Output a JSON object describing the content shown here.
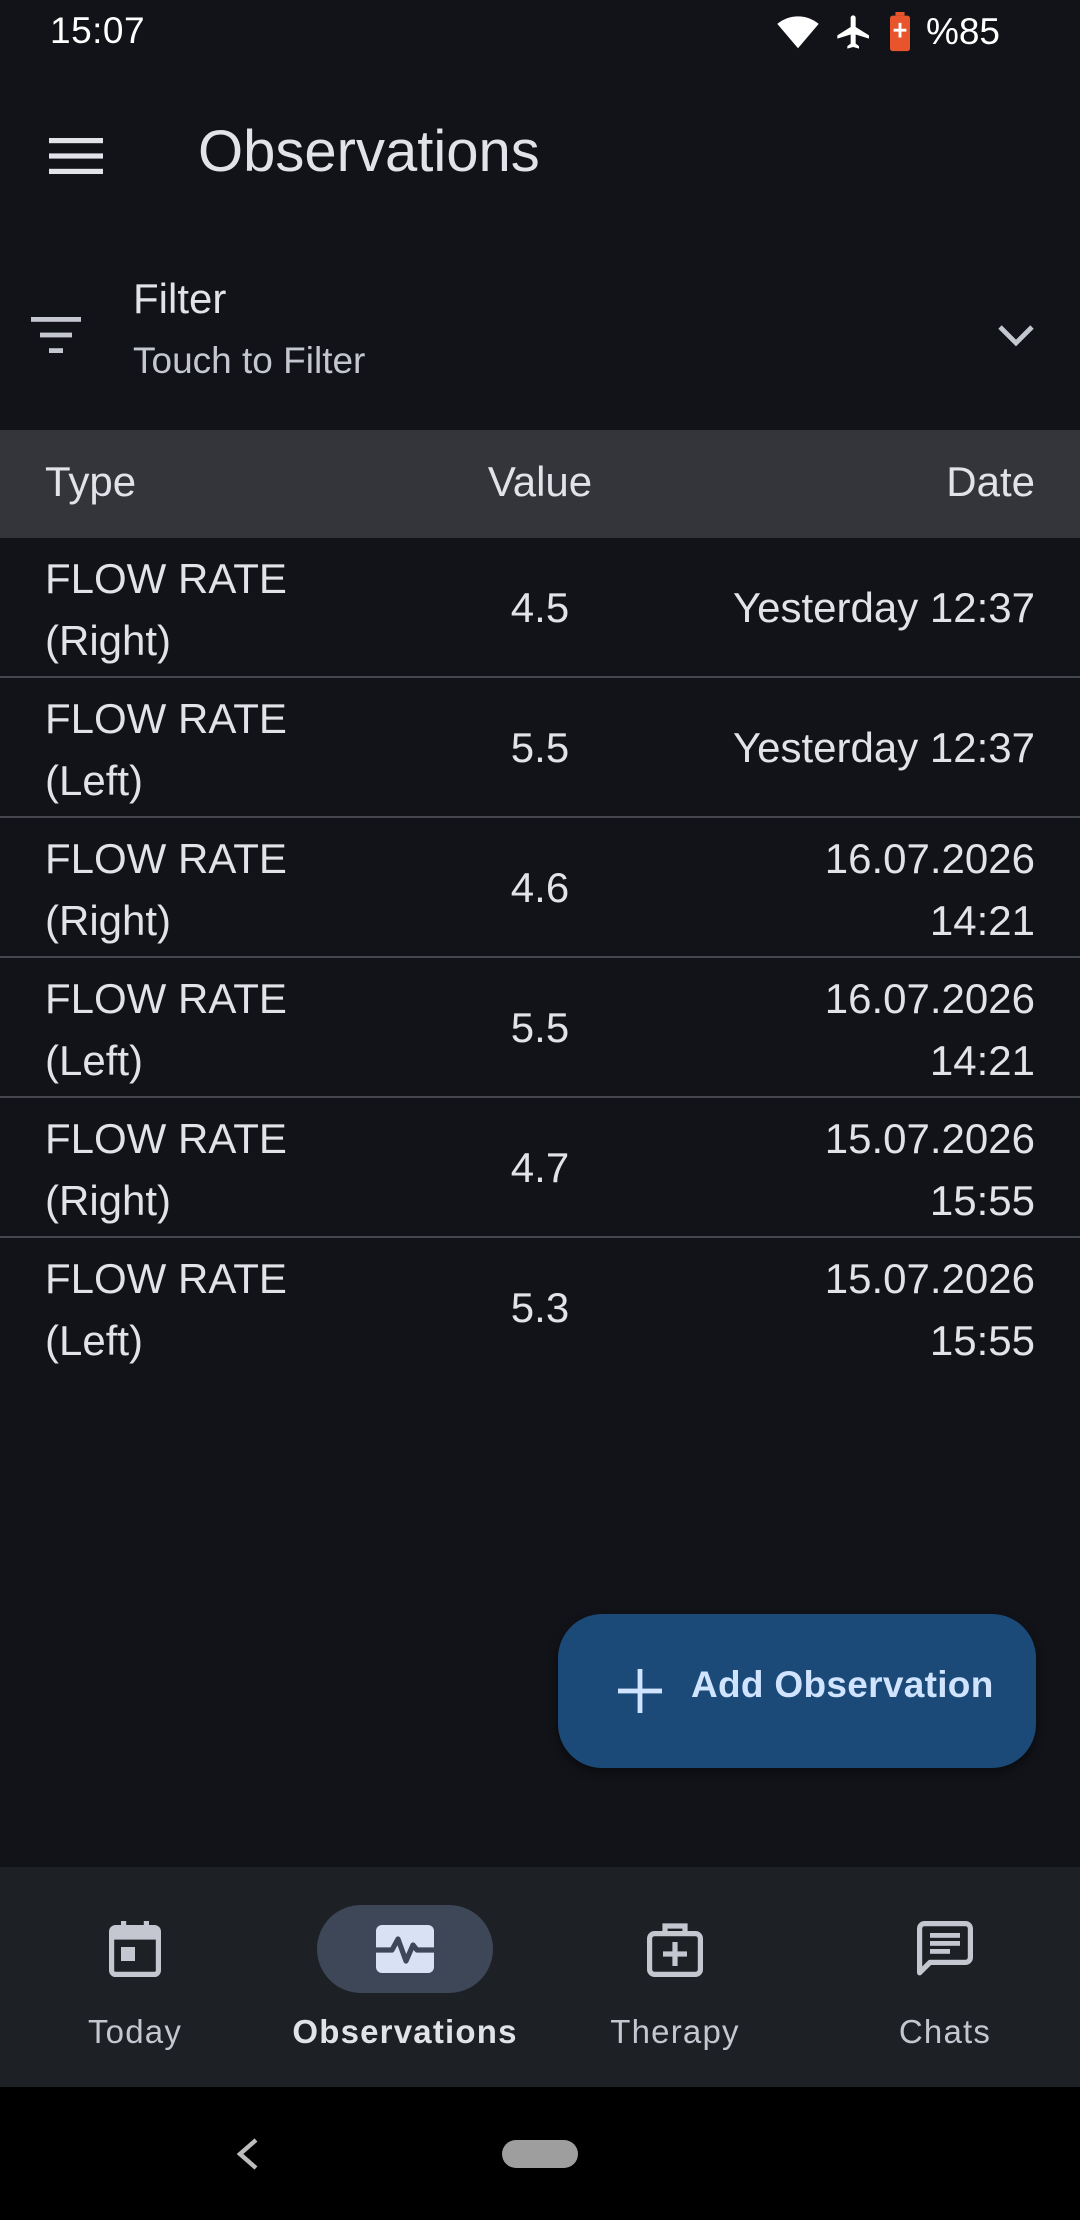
{
  "status_bar": {
    "time": "15:07",
    "battery_percent": "%85",
    "icons": [
      "wifi-icon",
      "airplane-mode-icon",
      "battery-icon"
    ],
    "battery_color": "#e8552d"
  },
  "app_bar": {
    "title": "Observations",
    "menu_icon": "menu-icon"
  },
  "filter": {
    "title": "Filter",
    "subtitle": "Touch to Filter",
    "icon": "filter-icon",
    "expand_icon": "chevron-down-icon"
  },
  "table": {
    "headers": {
      "type": "Type",
      "value": "Value",
      "date": "Date"
    },
    "rows": [
      {
        "type_line1": "FLOW RATE",
        "type_line2": "(Right)",
        "value": "4.5",
        "date_line1": "Yesterday 12:37",
        "date_line2": ""
      },
      {
        "type_line1": "FLOW RATE",
        "type_line2": "(Left)",
        "value": "5.5",
        "date_line1": "Yesterday 12:37",
        "date_line2": ""
      },
      {
        "type_line1": "FLOW RATE",
        "type_line2": "(Right)",
        "value": "4.6",
        "date_line1": "16.07.2026",
        "date_line2": "14:21"
      },
      {
        "type_line1": "FLOW RATE",
        "type_line2": "(Left)",
        "value": "5.5",
        "date_line1": "16.07.2026",
        "date_line2": "14:21"
      },
      {
        "type_line1": "FLOW RATE",
        "type_line2": "(Right)",
        "value": "4.7",
        "date_line1": "15.07.2026",
        "date_line2": "15:55"
      },
      {
        "type_line1": "FLOW RATE",
        "type_line2": "(Left)",
        "value": "5.3",
        "date_line1": "15.07.2026",
        "date_line2": "15:55"
      }
    ]
  },
  "fab": {
    "label": "Add Observation",
    "icon": "plus-icon",
    "color": "#1b4a78"
  },
  "bottom_nav": {
    "items": [
      {
        "label": "Today",
        "icon": "calendar-icon",
        "active": false
      },
      {
        "label": "Observations",
        "icon": "monitor-heart-icon",
        "active": true
      },
      {
        "label": "Therapy",
        "icon": "medical-bag-icon",
        "active": false
      },
      {
        "label": "Chats",
        "icon": "chat-icon",
        "active": false
      }
    ]
  },
  "system_nav": {
    "icons": [
      "back-icon",
      "home-pill"
    ]
  }
}
